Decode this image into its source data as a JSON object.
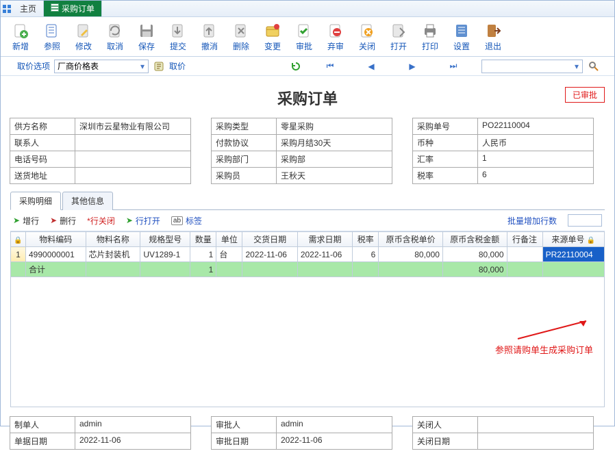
{
  "tabs": {
    "home": "主页",
    "active": "采购订单"
  },
  "toolbar": [
    {
      "id": "new",
      "label": "新增"
    },
    {
      "id": "ref",
      "label": "参照"
    },
    {
      "id": "edit",
      "label": "修改"
    },
    {
      "id": "cancel",
      "label": "取消"
    },
    {
      "id": "save",
      "label": "保存"
    },
    {
      "id": "submit",
      "label": "提交"
    },
    {
      "id": "revoke",
      "label": "撤消"
    },
    {
      "id": "delete",
      "label": "删除"
    },
    {
      "id": "change",
      "label": "变更"
    },
    {
      "id": "approve",
      "label": "审批"
    },
    {
      "id": "reject",
      "label": "弃审"
    },
    {
      "id": "close",
      "label": "关闭"
    },
    {
      "id": "open",
      "label": "打开"
    },
    {
      "id": "print",
      "label": "打印"
    },
    {
      "id": "settings",
      "label": "设置"
    },
    {
      "id": "exit",
      "label": "退出"
    }
  ],
  "subbar": {
    "opt_label": "取价选项",
    "price_list": "厂商价格表",
    "fetch": "取价"
  },
  "title": "采购订单",
  "status_badge": "已审批",
  "form": {
    "left": [
      [
        "供方名称",
        "深圳市云星物业有限公司"
      ],
      [
        "联系人",
        ""
      ],
      [
        "电话号码",
        ""
      ],
      [
        "送货地址",
        ""
      ]
    ],
    "mid": [
      [
        "采购类型",
        "零星采购"
      ],
      [
        "付款协议",
        "采购月结30天"
      ],
      [
        "采购部门",
        "采购部"
      ],
      [
        "采购员",
        "王秋天"
      ]
    ],
    "right": [
      [
        "采购单号",
        "PO22110004"
      ],
      [
        "币种",
        "人民币"
      ],
      [
        "汇率",
        "1"
      ],
      [
        "税率",
        "6"
      ]
    ]
  },
  "subtabs": {
    "detail": "采购明细",
    "other": "其他信息"
  },
  "linebar": {
    "add": "增行",
    "del": "删行",
    "close": "*行关闭",
    "open": "行打开",
    "tag": "标签",
    "batch": "批量增加行数"
  },
  "columns": [
    "",
    "物料编码",
    "物料名称",
    "规格型号",
    "数量",
    "单位",
    "交货日期",
    "需求日期",
    "税率",
    "原币含税单价",
    "原币含税金额",
    "行备注",
    "来源单号"
  ],
  "rows": [
    {
      "n": "1",
      "code": "4990000001",
      "name": "芯片封装机",
      "spec": "UV1289-1",
      "qty": "1",
      "unit": "台",
      "ddate": "2022-11-06",
      "rdate": "2022-11-06",
      "tax": "6",
      "price": "80,000",
      "amt": "80,000",
      "remark": "",
      "src": "PR22110004"
    }
  ],
  "total": {
    "label": "合计",
    "qty": "1",
    "amt": "80,000"
  },
  "annotation": "参照请购单生成采购订单",
  "footer": {
    "left": [
      [
        "制单人",
        "admin"
      ],
      [
        "单据日期",
        "2022-11-06"
      ]
    ],
    "mid": [
      [
        "审批人",
        "admin"
      ],
      [
        "审批日期",
        "2022-11-06"
      ]
    ],
    "right": [
      [
        "关闭人",
        ""
      ],
      [
        "关闭日期",
        ""
      ]
    ]
  }
}
